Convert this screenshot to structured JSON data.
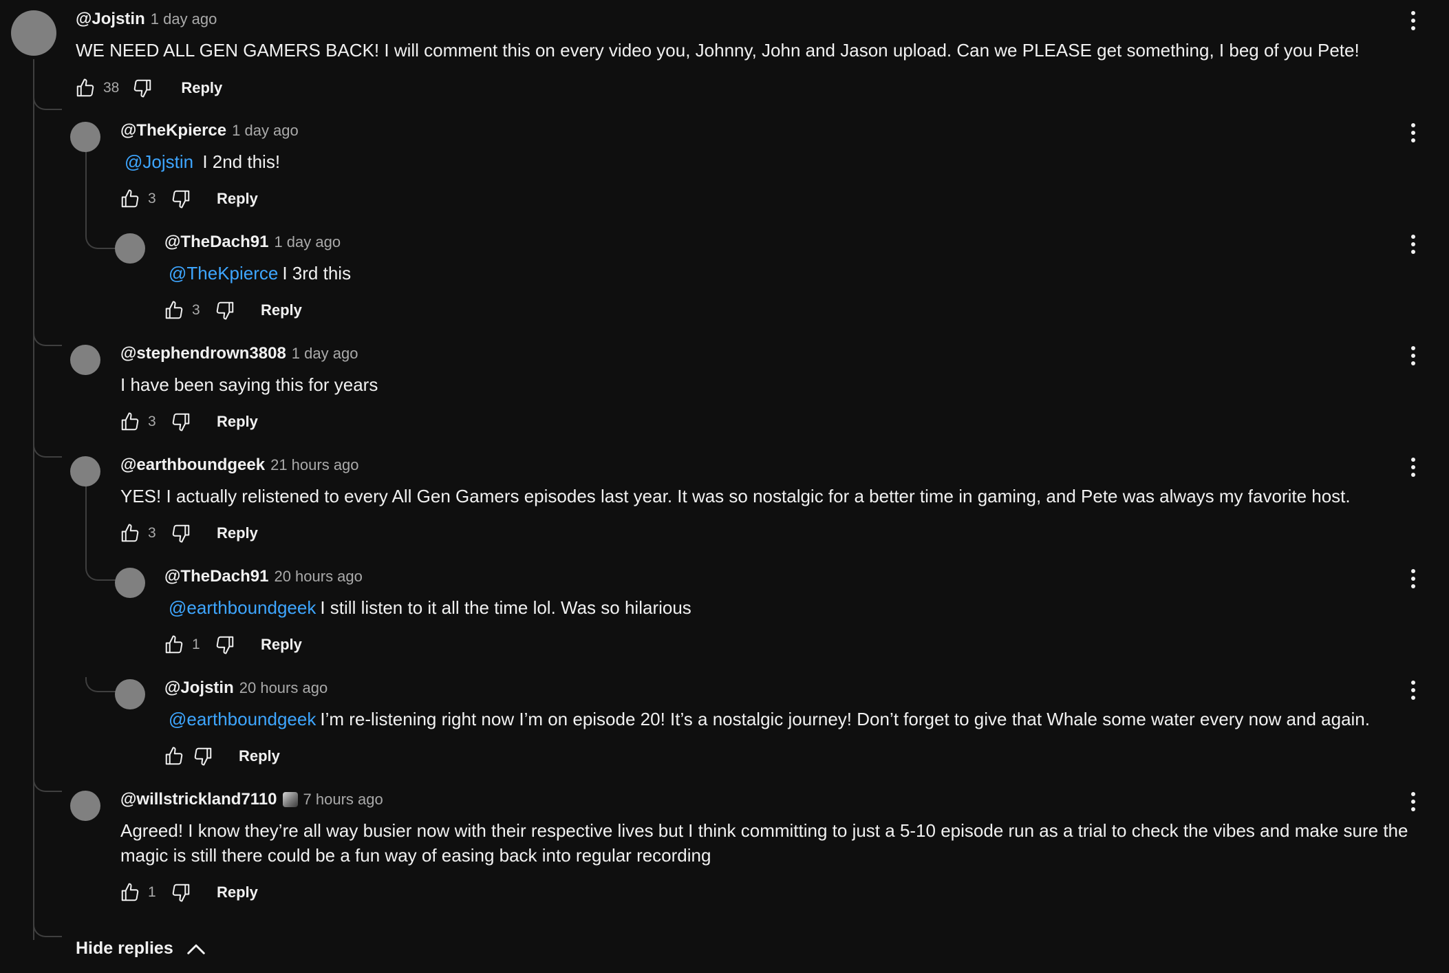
{
  "comments": [
    {
      "author": "@Jojstin",
      "time": "1 day ago",
      "mention": "",
      "text": "WE NEED ALL GEN GAMERS BACK! I will comment this on every video you, Johnny, John and Jason upload. Can we PLEASE get something, I beg of you Pete!",
      "likes": "38",
      "reply_label": "Reply"
    },
    {
      "author": "@TheKpierce",
      "time": "1 day ago",
      "mention": "@Jojstin",
      "text": " I 2nd this!",
      "likes": "3",
      "reply_label": "Reply"
    },
    {
      "author": "@TheDach91",
      "time": "1 day ago",
      "mention": "@TheKpierce",
      "text": "I 3rd this",
      "likes": "3",
      "reply_label": "Reply"
    },
    {
      "author": "@stephendrown3808",
      "time": "1 day ago",
      "mention": "",
      "text": "I have been saying this for years",
      "likes": "3",
      "reply_label": "Reply"
    },
    {
      "author": "@earthboundgeek",
      "time": "21 hours ago",
      "mention": "",
      "text": "YES! I actually relistened to every All Gen Gamers episodes  last year. It was so nostalgic for a better time in gaming, and Pete was always my favorite host.",
      "likes": "3",
      "reply_label": "Reply"
    },
    {
      "author": "@TheDach91",
      "time": "20 hours ago",
      "mention": "@earthboundgeek",
      "text": "I still listen to it all the time lol. Was so hilarious",
      "likes": "1",
      "reply_label": "Reply"
    },
    {
      "author": "@Jojstin",
      "time": "20 hours ago",
      "mention": "@earthboundgeek",
      "text": "I’m re-listening right now I’m on episode 20! It’s a nostalgic journey! Don’t forget to give that Whale some water every now and again.",
      "likes": "",
      "reply_label": "Reply"
    },
    {
      "author": "@willstrickland7110",
      "time": "7 hours ago",
      "mention": "",
      "text": "Agreed! I know they’re all way busier now with their respective lives but I think committing to just a 5-10 episode run as a trial to check the vibes and make sure the magic is still there could be a fun way of easing back into regular recording",
      "likes": "1",
      "reply_label": "Reply"
    }
  ],
  "hide_replies_label": "Hide replies",
  "colors": {
    "background": "#0f0f0f",
    "text": "#f1f1f1",
    "muted": "#aaaaaa",
    "mention": "#3ea6ff",
    "avatar": "#808080"
  }
}
